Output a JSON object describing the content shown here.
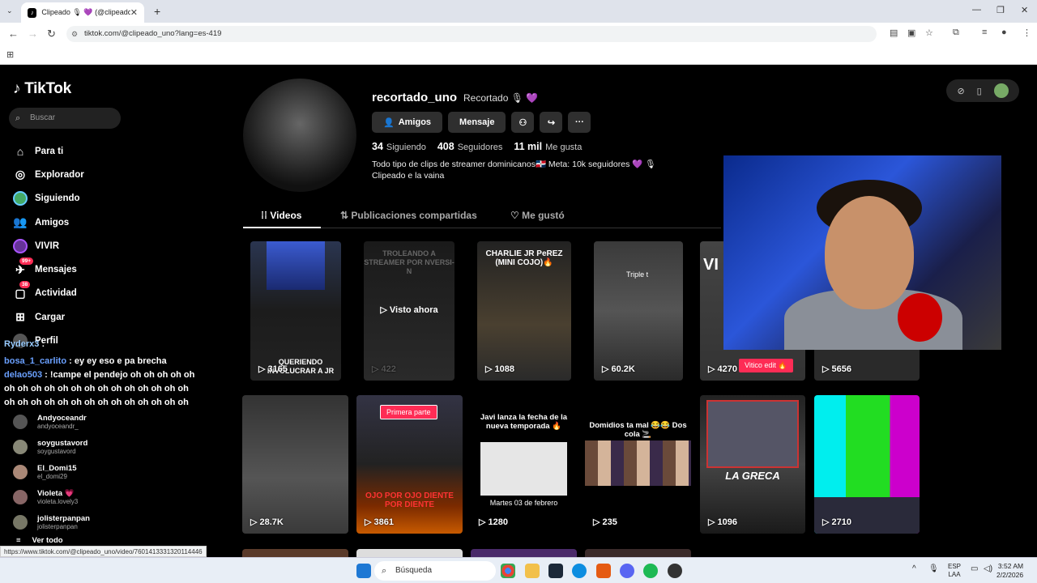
{
  "browser": {
    "tab_title": "Clipeado 🎙 💜 (@clipeado_un",
    "url": "tiktok.com/@clipeado_uno?lang=es-419",
    "status_url": "https://www.tiktok.com/@clipeado_uno/video/7601413331320114446"
  },
  "sidebar": {
    "logo": "TikTok",
    "search_placeholder": "Buscar",
    "items": [
      {
        "label": "Para ti",
        "icon": "home-icon"
      },
      {
        "label": "Explorador",
        "icon": "compass-icon"
      },
      {
        "label": "Siguiendo",
        "icon": "following-avatar-icon"
      },
      {
        "label": "Amigos",
        "icon": "friends-icon"
      },
      {
        "label": "VIVIR",
        "icon": "live-icon"
      },
      {
        "label": "Mensajes",
        "icon": "message-icon",
        "badge": "99+"
      },
      {
        "label": "Actividad",
        "icon": "activity-icon",
        "badge": "38"
      },
      {
        "label": "Cargar",
        "icon": "upload-icon"
      },
      {
        "label": "Perfil",
        "icon": "profile-icon"
      }
    ],
    "following": [
      {
        "name": "Andyoceandr",
        "handle": "andyoceandr_"
      },
      {
        "name": "soygustavord",
        "handle": "soygustavord"
      },
      {
        "name": "El_Domi15",
        "handle": "el_domi29"
      },
      {
        "name": "Violeta 💗",
        "handle": "violeta.lovely3"
      },
      {
        "name": "jolisterpanpan",
        "handle": "jolisterpanpan"
      }
    ],
    "see_all": "Ver todo"
  },
  "chat": [
    {
      "user": "Ryderx3",
      "text": ":"
    },
    {
      "user": "bosa_1_carlito",
      "text": ": ey ey eso e pa brecha"
    },
    {
      "user": "delao503",
      "text": ": !campe el pendejo oh oh oh oh oh oh oh oh oh oh oh oh oh oh oh oh oh oh oh oh oh oh oh oh oh oh oh oh oh oh oh oh oh oh oh oh oh oh oh oh oh oh"
    }
  ],
  "profile": {
    "username": "recortado_uno",
    "display_name": "Recortado 🎙 💜",
    "buttons": {
      "friends": "Amigos",
      "message": "Mensaje"
    },
    "stats": {
      "following_count": "34",
      "following_label": "Siguiendo",
      "followers_count": "408",
      "followers_label": "Seguidores",
      "likes_count": "11 mil",
      "likes_label": "Me gusta"
    },
    "bio_line1": "Todo tipo de clips de streamer dominicanos🇩🇴 Meta: 10k seguidores 💜 🎙",
    "bio_line2": "Clipeado e la vaina",
    "tabs": [
      "Videos",
      "Publicaciones compartidas",
      "Me gustó"
    ]
  },
  "videos": [
    {
      "views": "3165",
      "caption": "QUERIENDO INVOLUCRAR A JR"
    },
    {
      "views": "422",
      "caption": "TROLEANDO A STREAMER POR NVERSI-N",
      "overlay": "Visto ahora"
    },
    {
      "views": "1088",
      "caption": "CHARLIE JR PeREZ (MINI COJO)🔥"
    },
    {
      "views": "60.2K",
      "caption": "Triple t"
    },
    {
      "views": "4270",
      "caption": "VI"
    },
    {
      "views": "5656",
      "caption": ""
    },
    {
      "views": "28.7K",
      "caption": ""
    },
    {
      "views": "3861",
      "caption": "OJO POR OJO DIENTE POR DIENTE",
      "pill": "Primera parte"
    },
    {
      "views": "1280",
      "caption": "Javi lanza la fecha de la nueva temporada 🔥",
      "footer": "Martes 03 de febrero"
    },
    {
      "views": "235",
      "caption": "Domidios ta mal 😂😂 Dos cola 🚬"
    },
    {
      "views": "1096",
      "caption": "LA GRECA"
    },
    {
      "views": "2710",
      "caption": ""
    }
  ],
  "vitico_pill": "Vitico edit 🔥",
  "taskbar": {
    "search": "Búsqueda",
    "lang1": "ESP",
    "lang2": "LAA",
    "time": "3:52 AM",
    "date": "2/2/2026"
  }
}
